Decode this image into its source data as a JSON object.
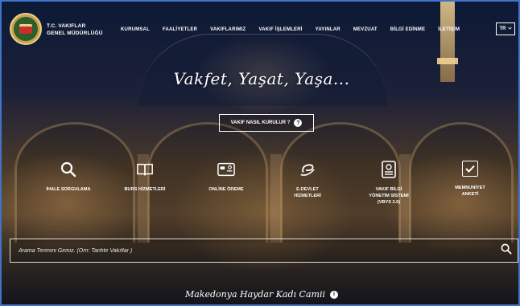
{
  "brand": {
    "line1": "T.C. VAKIFLAR",
    "line2": "GENEL MÜDÜRLÜĞÜ"
  },
  "nav": [
    {
      "label": "KURUMSAL"
    },
    {
      "label": "FAALİYETLER"
    },
    {
      "label": "VAKIFLARIMIZ"
    },
    {
      "label": "VAKIF İŞLEMLERİ"
    },
    {
      "label": "YAYINLAR"
    },
    {
      "label": "MEVZUAT"
    },
    {
      "label": "BİLGİ EDİNME"
    },
    {
      "label": "İLETİŞİM"
    }
  ],
  "language": {
    "selected": "TR"
  },
  "slogan": "Vakfet, Yaşat, Yaşa...",
  "how_button": {
    "label": "VAKIF NASIL KURULUR ?",
    "icon": "question-icon"
  },
  "services": [
    {
      "label": "İHALE SORGULAMA",
      "icon": "search-icon"
    },
    {
      "label": "BURS HİZMETLERİ",
      "icon": "book-icon"
    },
    {
      "label": "ONLİNE ÖDEME",
      "icon": "credit-card-icon"
    },
    {
      "label": "E-DEVLET\nHİZMETLERİ",
      "icon": "e-devlet-icon"
    },
    {
      "label": "VAKIF BİLGİ\nYÖNETİM SİSTEMİ\n(VBYS 2.0)",
      "icon": "document-icon"
    },
    {
      "label": "MEMNUNİYET\nANKETİ",
      "icon": "checkbox-icon"
    }
  ],
  "search": {
    "placeholder": "Arama Terimini Giriniz. (Örn: Tarihte Vakıflar )"
  },
  "caption": {
    "text": "Makedonya Haydar Kadı Camii"
  },
  "colors": {
    "border_accent": "#3f74c6",
    "text": "#ffffff"
  }
}
